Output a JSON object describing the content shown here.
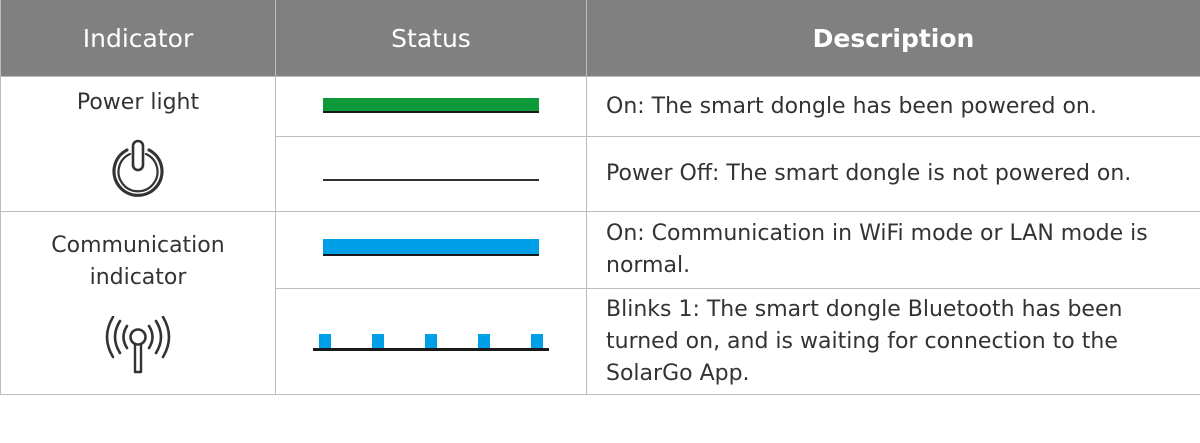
{
  "header": {
    "indicator": "Indicator",
    "status": "Status",
    "description": "Description"
  },
  "rows": [
    {
      "indicator": "Power light",
      "icon": "power-icon",
      "states": [
        {
          "status": "solid-on",
          "color": "#0e9a3b",
          "description": "On: The smart dongle has been powered on."
        },
        {
          "status": "off",
          "color": "#333333",
          "description": "Power Off: The smart dongle is not powered on."
        }
      ]
    },
    {
      "indicator": "Communication\nindicator",
      "icon": "signal-antenna-icon",
      "states": [
        {
          "status": "solid-on",
          "color": "#00a0e8",
          "description": "On: Communication in WiFi mode or LAN mode is normal."
        },
        {
          "status": "blink-1",
          "color": "#00a0e8",
          "description": "Blinks 1: The smart dongle Bluetooth has been turned on, and is waiting for connection to the SolarGo App."
        }
      ]
    }
  ],
  "colors": {
    "header_bg": "#808080",
    "border": "#bdbdbd",
    "power_green": "#0e9a3b",
    "comm_blue": "#00a0e8"
  }
}
